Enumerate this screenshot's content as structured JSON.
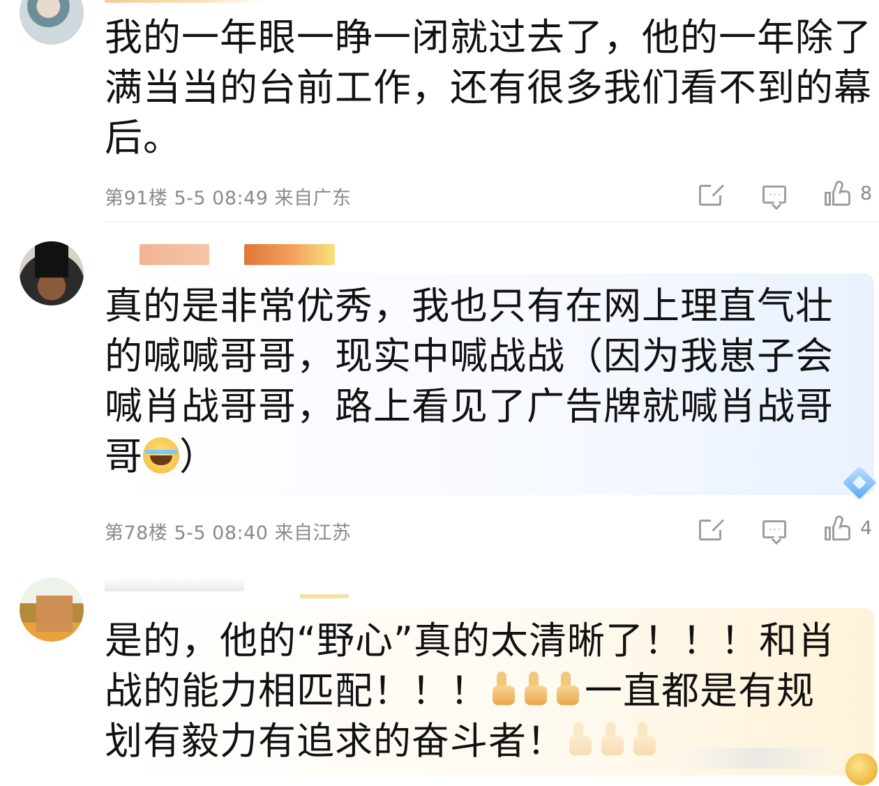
{
  "comments": [
    {
      "content": "我的一年眼一睁一闭就过去了，他的一年除了满当当的台前工作，还有很多我们看不到的幕后。",
      "floor": "第91楼",
      "time": "5-5 08:49",
      "location": "来自广东",
      "like_count": "8"
    },
    {
      "content_before_emoji": "真的是非常优秀，我也只有在网上理直气壮的喊喊哥哥，现实中喊战战（因为我崽子会喊肖战哥哥，路上看见了广告牌就喊肖战哥哥",
      "content_after_emoji": "）",
      "emoji": "laughing-tears-emoji",
      "floor": "第78楼",
      "time": "5-5 08:40",
      "location": "来自江苏",
      "like_count": "4"
    },
    {
      "content_part1": "是的，他的“野心”真的太清晰了！！！和肖战的能力相匹配！！！",
      "content_part2": "一直都是有规划有毅力有追求的奋斗者！",
      "emoji": "thumbs-up-emoji"
    }
  ],
  "icons": {
    "share": "share-icon",
    "comment": "comment-icon",
    "like": "thumbs-up-icon"
  },
  "colors": {
    "meta_text": "#8a8a8a",
    "icon": "#9e9e9e",
    "bubble_blue": "#eaf2ff",
    "bubble_gold": "#fff2d8"
  }
}
